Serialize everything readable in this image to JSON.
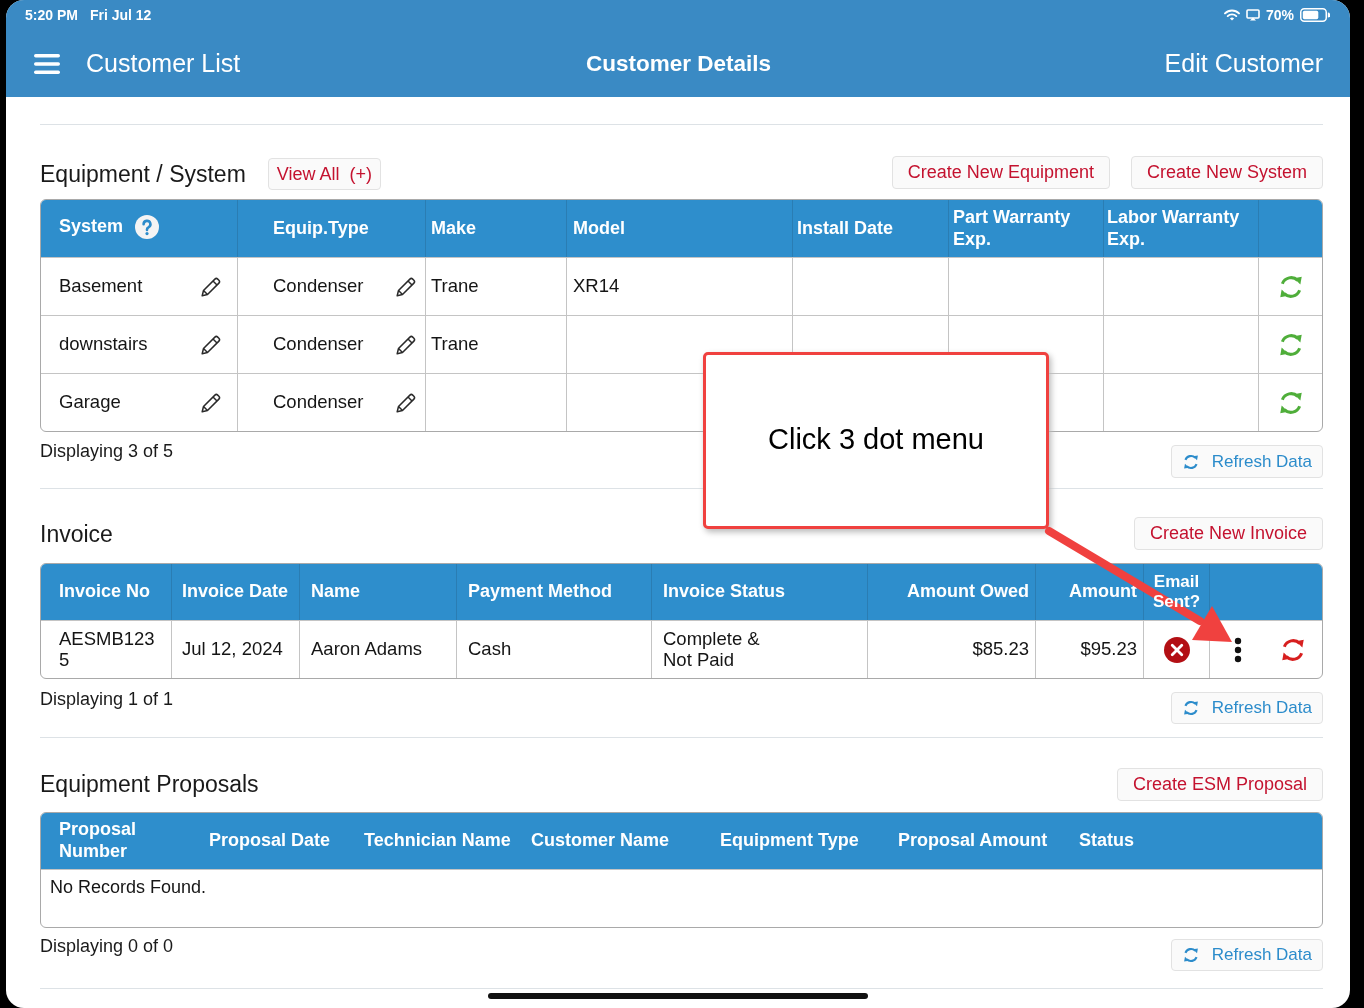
{
  "status_bar": {
    "time": "5:20 PM",
    "date": "Fri Jul 12",
    "battery": "70%"
  },
  "nav_bar": {
    "left": "Customer List",
    "title": "Customer Details",
    "right": "Edit Customer"
  },
  "equipment": {
    "title": "Equipment / System",
    "view_all": "View All  (+)",
    "buttons": [
      "Create New Equipment",
      "Create New System"
    ],
    "columns": [
      {
        "label": "System",
        "help": true
      },
      {
        "label": "Equip.Type",
        "help": false
      },
      {
        "label": "Make",
        "help": false
      },
      {
        "label": "Model",
        "help": false
      },
      {
        "label": "Install Date",
        "help": false
      },
      {
        "label": "Part Warranty Exp.",
        "help": false
      },
      {
        "label": "Labor Warranty Exp.",
        "help": false
      }
    ],
    "rows": [
      {
        "system": "Basement",
        "equip_type": "Condenser",
        "make": "Trane",
        "model": "XR14",
        "synced": true
      },
      {
        "system": "downstairs",
        "equip_type": "Condenser",
        "make": "Trane",
        "synced": true
      },
      {
        "system": "Garage",
        "equip_type": "Condenser",
        "synced": true
      }
    ],
    "count": "Displaying 3 of 5",
    "refresh": "Refresh Data"
  },
  "invoice": {
    "title": "Invoice",
    "buttons": [
      "Create New Invoice"
    ],
    "columns": [
      {
        "label": "Invoice No",
        "kind": "text"
      },
      {
        "label": "Invoice Date",
        "kind": "text"
      },
      {
        "label": "Name",
        "kind": "text"
      },
      {
        "label": "Payment Method",
        "kind": "text"
      },
      {
        "label": "Invoice Status",
        "kind": "text"
      },
      {
        "label": "Amount Owed",
        "kind": "money"
      },
      {
        "label": "Amount",
        "kind": "money"
      },
      {
        "label": "Email Sent?",
        "kind": "flag"
      }
    ],
    "rows": [
      {
        "invoice_no": "AESMB1235",
        "invoice_date": "Jul 12, 2024",
        "name": "Aaron Adams",
        "payment_method": "Cash",
        "invoice_status": "Complete &\nNot Paid",
        "amount_owed": "$85.23",
        "amount": "$95.23",
        "email_sent": false,
        "synced": false
      }
    ],
    "count": "Displaying 1 of 1",
    "refresh": "Refresh Data"
  },
  "proposals": {
    "title": "Equipment Proposals",
    "buttons": [
      "Create ESM Proposal"
    ],
    "columns": [
      "Proposal Number",
      "Proposal Date",
      "Technician Name",
      "Customer Name",
      "Equipment Type",
      "Proposal Amount",
      "Status"
    ],
    "empty": "No Records Found.",
    "count": "Displaying 0 of 0",
    "refresh": "Refresh Data"
  },
  "annotation": {
    "text": "Click 3 dot menu"
  }
}
